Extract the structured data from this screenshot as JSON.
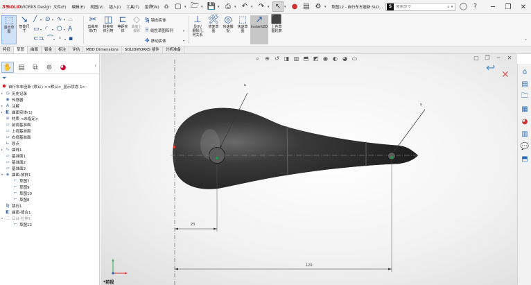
{
  "brand": {
    "ds": "3S",
    "solid": "SOLID",
    "works": "WORKS",
    "design": "Design"
  },
  "menu": [
    {
      "label": "文件(F)"
    },
    {
      "label": "编辑(E)"
    },
    {
      "label": "视图(V)"
    },
    {
      "label": "插入(I)"
    },
    {
      "label": "工具(T)"
    },
    {
      "label": "窗口(W)"
    }
  ],
  "document_title": "草图12 - 自行车车座新.SLD...",
  "search": {
    "placeholder": "搜索命令"
  },
  "ribbon": {
    "exit_sketch": "退出草\n图",
    "smart_dimension": "智能尺\n寸",
    "trim": "剪裁实\n体(T)",
    "convert": "转换实\n体引用",
    "offset": "等距实\n体",
    "surface_offset": "曲面上\n偏移",
    "mirror": "镜向实体",
    "linear_pattern": "线性草图阵列",
    "move": "移动实体",
    "display_relations": "显示/\n删除几\n何关系",
    "repair_sketch": "修复草\n图",
    "quick_snap": "快速捕\n捉",
    "rapid_sketch": "快速草\n图",
    "instant2d": "Instant2D",
    "shaded_sketch": "上色草\n图轮廓"
  },
  "tabs": [
    {
      "label": "特征"
    },
    {
      "label": "草图",
      "active": true
    },
    {
      "label": "曲面"
    },
    {
      "label": "钣金"
    },
    {
      "label": "标注"
    },
    {
      "label": "评估"
    },
    {
      "label": "MBD Dimensions"
    },
    {
      "label": "SOLIDWORKS 插件"
    },
    {
      "label": "分析准备"
    }
  ],
  "tree": {
    "root": "自行车车座新 (默认) <<默认>_显示状态 1>",
    "items": [
      {
        "label": "历史记录",
        "icon": "history-icon"
      },
      {
        "label": "传感器",
        "icon": "sensor-icon"
      },
      {
        "label": "注解",
        "icon": "annotation-icon"
      },
      {
        "label": "曲面实体(1)",
        "icon": "surface-body-icon"
      },
      {
        "label": "材质 <未指定>",
        "icon": "material-icon"
      },
      {
        "label": "前视基准面",
        "icon": "plane-icon"
      },
      {
        "label": "上视基准面",
        "icon": "plane-icon"
      },
      {
        "label": "右视基准面",
        "icon": "plane-icon"
      },
      {
        "label": "原点",
        "icon": "origin-icon"
      },
      {
        "label": "曲线1",
        "icon": "curve-icon"
      },
      {
        "label": "基准面1",
        "icon": "plane-icon"
      },
      {
        "label": "基准面2",
        "icon": "plane-icon"
      },
      {
        "label": "基准面3",
        "icon": "plane-icon"
      },
      {
        "label": "曲面-放样1",
        "icon": "loft-icon"
      },
      {
        "label": "草图7",
        "icon": "sketch-icon"
      },
      {
        "label": "草图9",
        "icon": "sketch-icon"
      },
      {
        "label": "草图10",
        "icon": "sketch-icon"
      },
      {
        "label": "草图8",
        "icon": "sketch-icon"
      },
      {
        "label": "镜向1",
        "icon": "mirror-icon"
      },
      {
        "label": "曲面-缝合1",
        "icon": "knit-icon"
      },
      {
        "label": "凸台-拉伸1",
        "icon": "extrude-icon"
      },
      {
        "label": "草图12",
        "icon": "sketch-icon"
      }
    ]
  },
  "viewport": {
    "view_label": "*前视",
    "dims": {
      "dia_left": "⌀",
      "dia_right": "⌀",
      "horiz_small": "23",
      "horiz_long": "120"
    }
  },
  "colors": {
    "accent": "#2a5caa",
    "brand_red": "#d2232a",
    "solid_fill": "#2b2b2b",
    "sketch_line": "#555555"
  }
}
